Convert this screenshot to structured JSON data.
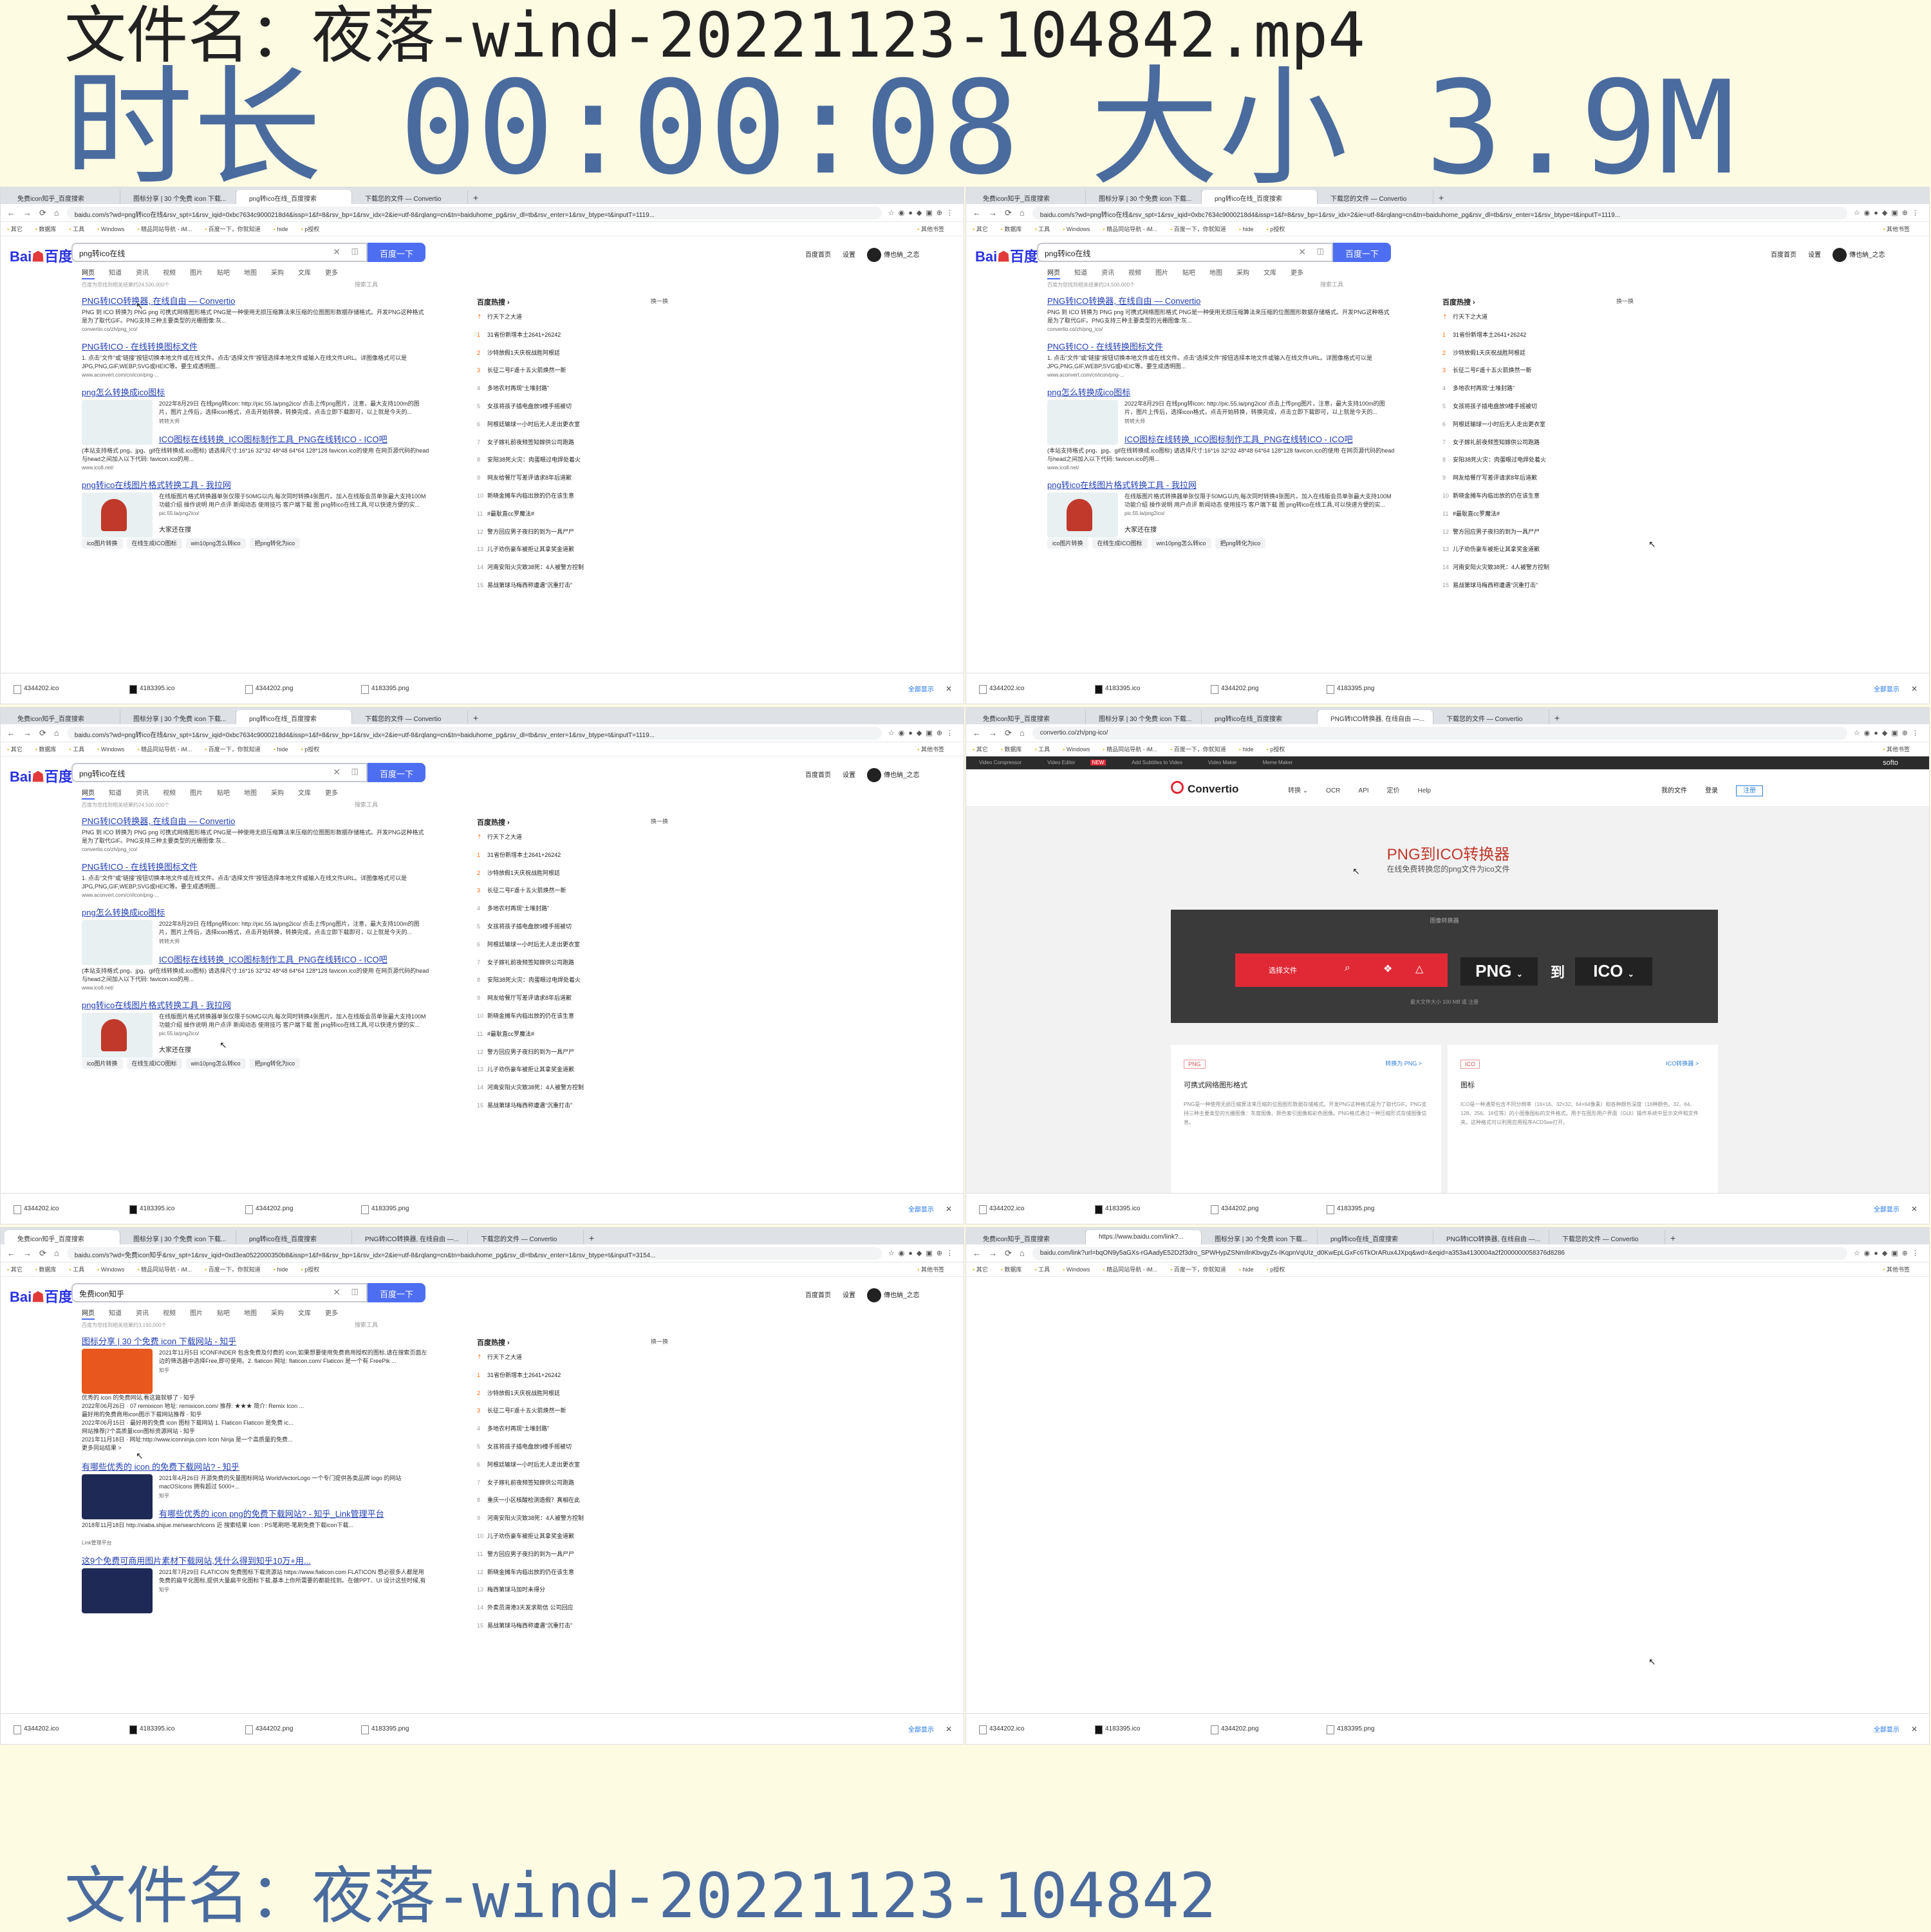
{
  "header": {
    "file_label": "文件名：夜落-wind-20221123-104842.mp4",
    "duration": "时长 00:00:08",
    "size": "大小 3.9M"
  },
  "footer": {
    "file_label": "文件名：夜落-wind-20221123-104842"
  },
  "browser": {
    "bookmarks": [
      "其它",
      "数据库",
      "工具",
      "Windows",
      "精品同站导航 - iM...",
      "百度一下，你就知道",
      "hide",
      "p授权"
    ],
    "other_bookmarks": "其他书签",
    "downloads": [
      "4344202.ico",
      "4183395.ico",
      "4344202.png",
      "4183395.png"
    ],
    "show_all": "全部显示"
  },
  "frames": [
    {
      "tabs": [
        "免费icon知乎_百度搜索",
        "图标分享 | 30 个免费 icon 下载...",
        "png转ico在线_百度搜索",
        "下载您的文件 — Convertio"
      ],
      "active_tab": 2,
      "url": "baidu.com/s?wd=png转ico在线&rsv_spt=1&rsv_iqid=0xbc7634c9000218d4&issp=1&f=8&rsv_bp=1&rsv_idx=2&ie=utf-8&rqlang=cn&tn=baiduhome_pg&rsv_dl=tb&rsv_enter=1&rsv_btype=t&inputT=1119..."
    },
    {
      "tabs": [
        "免费icon知乎_百度搜索",
        "图标分享 | 30 个免费 icon 下载...",
        "png转ico在线_百度搜索",
        "下载您的文件 — Convertio"
      ],
      "active_tab": 2,
      "url": "baidu.com/s?wd=png转ico在线&rsv_spt=1&rsv_iqid=0xbc7634c9000218d4&issp=1&f=8&rsv_bp=1&rsv_idx=2&ie=utf-8&rqlang=cn&tn=baiduhome_pg&rsv_dl=tb&rsv_enter=1&rsv_btype=t&inputT=1119..."
    },
    {
      "tabs": [
        "免费icon知乎_百度搜索",
        "图标分享 | 30 个免费 icon 下载...",
        "png转ico在线_百度搜索",
        "下载您的文件 — Convertio"
      ],
      "active_tab": 2,
      "url": "baidu.com/s?wd=png转ico在线&rsv_spt=1&rsv_iqid=0xbc7634c9000218d4&issp=1&f=8&rsv_bp=1&rsv_idx=2&ie=utf-8&rqlang=cn&tn=baiduhome_pg&rsv_dl=tb&rsv_enter=1&rsv_btype=t&inputT=1119..."
    },
    {
      "tabs": [
        "免费icon知乎_百度搜索",
        "图标分享 | 30 个免费 icon 下载...",
        "png转ico在线_百度搜索",
        "PNG转ICO转换器, 在线自由 —...",
        "下载您的文件 — Convertio"
      ],
      "active_tab": 3,
      "url": "convertio.co/zh/png-ico/"
    },
    {
      "tabs": [
        "免费icon知乎_百度搜索",
        "图标分享 | 30 个免费 icon 下载...",
        "png转ico在线_百度搜索",
        "PNG转ICO转换器, 在线自由 —...",
        "下载您的文件 — Convertio"
      ],
      "active_tab": 0,
      "url": "baidu.com/s?wd=免费icon知乎&rsv_spt=1&rsv_iqid=0xd3ea0522000350b8&issp=1&f=8&rsv_bp=1&rsv_idx=2&ie=utf-8&rqlang=cn&tn=baiduhome_pg&rsv_dl=tb&rsv_enter=1&rsv_btype=t&inputT=3154..."
    },
    {
      "tabs": [
        "免费icon知乎_百度搜索",
        "https://www.baidu.com/link?...",
        "图标分享 | 30 个免费 icon 下载...",
        "png转ico在线_百度搜索",
        "PNG转ICO转换器, 在线自由 —...",
        "下载您的文件 — Convertio"
      ],
      "active_tab": 1,
      "url": "baidu.com/link?url=bqON9y5aGXs-rGAadyE52D2f3dro_SPWHypZSNmIlnKbvgyZs-IKqpnVqUIz_d0KwEpLGxFc6TkOrARux4JXpq&wd=&eqid=a353a4130004a2f2000000058376d8286"
    }
  ],
  "baidu": {
    "logo_text": "Bai",
    "logo_suffix": "百度",
    "button": "百度一下",
    "right_links": [
      "百度首页",
      "设置"
    ],
    "user": "傳也納_之恋",
    "tabs": [
      "网页",
      "知道",
      "资讯",
      "视频",
      "图片",
      "贴吧",
      "地图",
      "采购",
      "文库",
      "更多"
    ],
    "search_tools": "搜索工具",
    "hot_title": "百度热搜",
    "hot_swap": "换一换",
    "also_title": "大家还在搜",
    "also_tags": [
      "ico图片转换",
      "在线生成ICO图标",
      "win10png怎么转ico",
      "把png转化为ico"
    ],
    "query_png": "png转ico在线",
    "count_png": "百度为您找到相关结果约24,500,000个",
    "results_png": [
      {
        "title": "PNG转ICO转换器, 在线自由 — Convertio",
        "desc": "PNG 到 ICO 转换为 PNG png 可携式网络图形格式 PNG是一种使用无损压缩算法来压缩的位图图形数据存储格式。开发PNG这种格式是为了取代GIF。PNG支持三种主要类型的光栅图像:灰...",
        "src": "convertio.co/zh/png_ico/"
      },
      {
        "title": "PNG转ICO - 在线转换图标文件",
        "desc": "1. 点击“文件”或“链接”按钮切换本地文件或在线文件。点击“选择文件”按钮选择本地文件或输入在线文件URL。详图像格式可以是JPG,PNG,GIF,WEBP,SVG或HEIC等。要生成透明图...",
        "src": "www.aconvert.com/cn/icon/png-..."
      },
      {
        "title": "png怎么转换成ico图标",
        "desc": "2022年8月29日 在线png转icon: http://pic.55.la/png2ico/ 点击上传png图片，注意，最大支持100m的图片，图片上传后，选择icon格式，点击开始转换，转换完成，点击立即下载即可，以上就是今天的...",
        "src": "转转大师"
      },
      {
        "title": "ICO图标在线转换_ICO图标制作工具_PNG在线转ICO - ICO吧",
        "desc": "(本站支持格式 png、jpg、gif在线转换成.ico图标) 请选择尺寸:16*16 32*32 48*48 64*64 128*128 favicon.ico的使用 在网页源代码的head与head之间加入以下代码: favicon.ico的用...",
        "src": "www.ico8.net/"
      },
      {
        "title": "png转ico在线图片格式转换工具 - 我拉网",
        "desc": "在线版图片格式转换器单张仅限于50MG以内,每次同时转换4张图片。加入在线版会员单张最大支持100M 功能介绍 操作说明 用户点评 新闻动态 使用技巧 客户端下载 图 png转ico在线工具,可以快速方便的实...",
        "src": "pic.55.la/png2ico/"
      }
    ],
    "query_zhihu": "免费icon知乎",
    "count_zhihu": "百度为您找到相关结果约3,190,000个",
    "results_zhihu": [
      {
        "title": "图标分享 | 30 个免费 icon 下载网站 - 知乎",
        "desc": "2021年11月5日 ICONFINDER 包含免费及付费的 icon,如果想要使用免费商用授权的图标,请在搜索页面左边的筛选器中选择Free,即可使用。2. flaticon 网址: flaticon.com/ Flaticon 是一个有 FreePik ...",
        "src": "知乎"
      },
      {
        "title": "有哪些优秀的 icon 的免费下载网站? - 知乎",
        "desc": "2021年4月26日 开源免费的矢量图标网站 WorldVectorLogo 一个专门提供各类品牌 logo 的网站 macOSIcons 拥有超过 5000+...",
        "src": "知乎"
      },
      {
        "title": "有哪些优秀的 icon png的免费下载网站? - 知乎_Link管理平台",
        "desc": "2018年11月18日 http://xiaba.shijue.me/search/icons 近 搜索结果 Icon : PS笔刷吧-笔刷免费下载icon下载...",
        "src": "Link管理平台"
      },
      {
        "title": "这9个免费可商用图片素材下载网站,凭什么得到知乎10万+用...",
        "desc": "2021年7月29日 FLATICON 免费图标下载资源站 https://www.flaticon.com FLATICON 想必很多人都是用免费的扁平化图标,提供大量扁平化图标下载,基本上你所需要的都能找到。在做PPT、UI 设计这些时候,有图标直...",
        "src": "知乎"
      }
    ],
    "zhihu_extra": [
      "优秀的 icon 的免费网站,看这篇就够了 - 知乎",
      "2022年06月26日 · 07 remixicon 地址: remixicon.com/ 推荐: ★★★ 简介: Remix Icon ...",
      "最好用的免费商用icon图示下载网站推荐 - 知乎",
      "2022年06月15日 · 最好用的免费 icon 图标下载网站 1. Flaticon Flaticon 是免费 ic...",
      "网站推荐|7个高质量icon图标资源网站 - 知乎",
      "2021年11月18日 · 网址:http://www.iconninja.com Icon Ninja 是一个高质量的免费...",
      "更多同站结果 >"
    ],
    "hot_png": [
      "行天下之大道",
      "31省份新增本土2641+26242",
      "沙特放假1天庆祝战胜阿根廷",
      "长征二号F遥十五火箭焕然一新",
      "多地农村再现“土堆封路”",
      "女孩将孩子插电盘放9楼手摇被切",
      "阿根廷输球一小时后无人走出更衣室",
      "女子嫁礼前夜频签知嫁供公司跑路",
      "安阳38死火灾：肉蛋眼过电焊处着火",
      "网友给餐厅写差评请求8年后道歉",
      "新晓金摊车内临出放的仍在该生意",
      "#最耿直cc罗魔法#",
      "警方回应男子夜扫的到为一具尸尸",
      "儿子劝伤豪车被拒让其拿奖金道歉",
      "河南安阳火灾致38死：4人被警方控制",
      "易战第球马梅西称遭遇“沉重打击”"
    ],
    "hot_zhihu": [
      "行天下之大道",
      "31省份新增本土2641+26242",
      "沙特放假1天庆祝战胜阿根廷",
      "长征二号F遥十五火箭焕然一新",
      "多地农村再现“土堆封路”",
      "女孩将孩子插电盘放9楼手摇被切",
      "阿根廷输球一小时后无人走出更衣室",
      "女子嫁礼前夜频签知嫁供公司跑路",
      "重庆一小区核酸检测造假？真相在此",
      "河南安阳火灾致38死：4人被警方控制",
      "儿子劝伤豪车被拒让其拿奖金道歉",
      "警方回应男子夜扫的到为一具尸尸",
      "新晓金摊车内临出放的仍在该生意",
      "梅西第球马加时未得分",
      "外卖员滞港3天发求助信 公司回应",
      "易战第球马梅西称遭遇“沉重打击”"
    ]
  },
  "convertio": {
    "top_links": [
      "Video Compressor",
      "Video Editor",
      "Add Subtitles to Video",
      "Video Maker",
      "Meme Maker"
    ],
    "new_badge": "NEW",
    "softo": "softo",
    "logo": "Convertio",
    "menu": [
      "转换 ⌄",
      "OCR",
      "API",
      "定价",
      "Help"
    ],
    "right": [
      "我的文件",
      "登录",
      "注册"
    ],
    "title": "PNG到ICO转换器",
    "subtitle": "在线免费转换您的png文件为ico文件",
    "box_label": "图像转换器",
    "choose": "选择文件",
    "from_fmt": "PNG",
    "to_word": "到",
    "to_fmt": "ICO",
    "note": "最大文件大小 100 MB 或 注册",
    "card_png": {
      "badge": "PNG",
      "link": "转换为 PNG >",
      "title": "可携式网络图形格式",
      "desc": "PNG是一种使用无损压缩算法来压缩的位图图形数据存储格式。开发PNG这种格式是为了取代GIF。PNG支持三种主要类型的光栅图像：灰度图像、颜色索引图像和彩色图像。PNG格式通过一种压缩形式存储图像信息。"
    },
    "card_ico": {
      "badge": "ICO",
      "link": "ICO转换器 >",
      "title": "图标",
      "desc": "ICO是一种通常包含不同分辨率（16×16、32×32、64×64像素）和各种颜色深度（16种颜色、32、64、128、256、16位等）的小图像图标的文件格式。用于在图形用户界面（GUI）操作系统中显示文件和文件夹。这种格式可以利用应用程序ACDSee打开。"
    }
  },
  "colors": {
    "background": "#fdfbe2",
    "accent_blue": "#4a6b9e",
    "baidu_blue": "#4e6ef2",
    "convertio_red": "#e02935"
  },
  "icons": [
    "mouse-cursor-icon",
    "download-file-icon",
    "back-arrow-icon",
    "reload-icon",
    "close-icon"
  ]
}
